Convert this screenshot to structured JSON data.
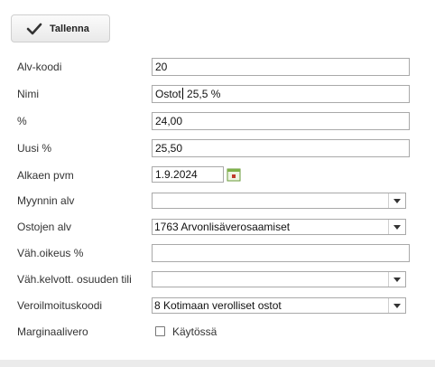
{
  "toolbar": {
    "save_label": "Tallenna",
    "save_icon": "check-icon"
  },
  "form": {
    "alv_koodi": {
      "label": "Alv-koodi",
      "value": "20"
    },
    "nimi": {
      "label": "Nimi",
      "value_before_cursor": "Ostot",
      "value_after_cursor": " 25,5 %"
    },
    "percent": {
      "label": "%",
      "value": "24,00"
    },
    "uusi_percent": {
      "label": "Uusi %",
      "value": "25,50"
    },
    "alkaen_pvm": {
      "label": "Alkaen pvm",
      "value": "1.9.2024",
      "icon": "calendar-icon"
    },
    "myynnin_alv": {
      "label": "Myynnin alv",
      "value": ""
    },
    "ostojen_alv": {
      "label": "Ostojen alv",
      "value": "1763 Arvonlisäverosaamiset"
    },
    "vah_oikeus": {
      "label": "Väh.oikeus %",
      "value": ""
    },
    "vah_kelvott": {
      "label": "Väh.kelvott. osuuden tili",
      "value": ""
    },
    "veroilmoituskoodi": {
      "label": "Veroilmoituskoodi",
      "value": "8 Kotimaan verolliset ostot"
    },
    "marginaalivero": {
      "label": "Marginaalivero",
      "checkbox_label": "Käytössä",
      "checked": false
    }
  }
}
